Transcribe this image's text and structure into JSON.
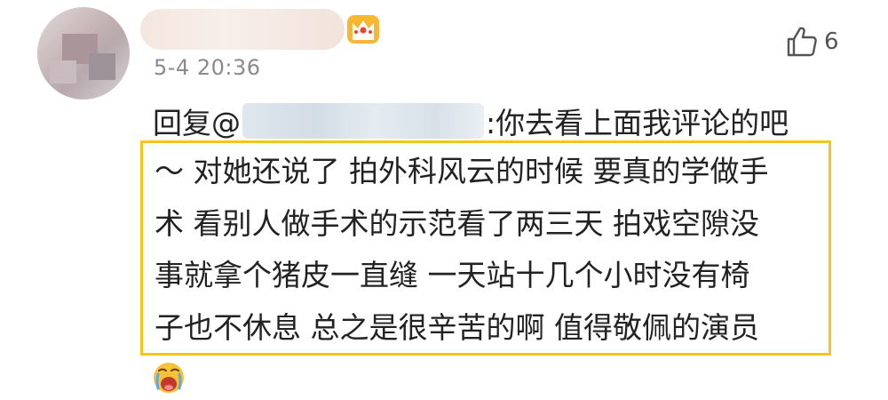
{
  "comment": {
    "timestamp": "5-4 20:36",
    "likes": "6",
    "reply_prefix": "回复@",
    "reply_suffix": ":你去看上面我评论的吧",
    "body_lines": [
      "～ 对她还说了 拍外科风云的时候 要真的学做手",
      "术 看别人做手术的示范看了两三天 拍戏空隙没",
      "事就拿个猪皮一直缝 一天站十几个小时没有椅",
      "子也不休息 总之是很辛苦的啊 值得敬佩的演员"
    ]
  },
  "icons": {
    "avatar": "blurred-avatar",
    "badge": "crown-icon",
    "like": "thumbs-up-icon",
    "emoji": "crying-face-emoji"
  },
  "colors": {
    "highlight_border": "#f5c518",
    "timestamp": "#8a8a8a",
    "text": "#222222"
  }
}
